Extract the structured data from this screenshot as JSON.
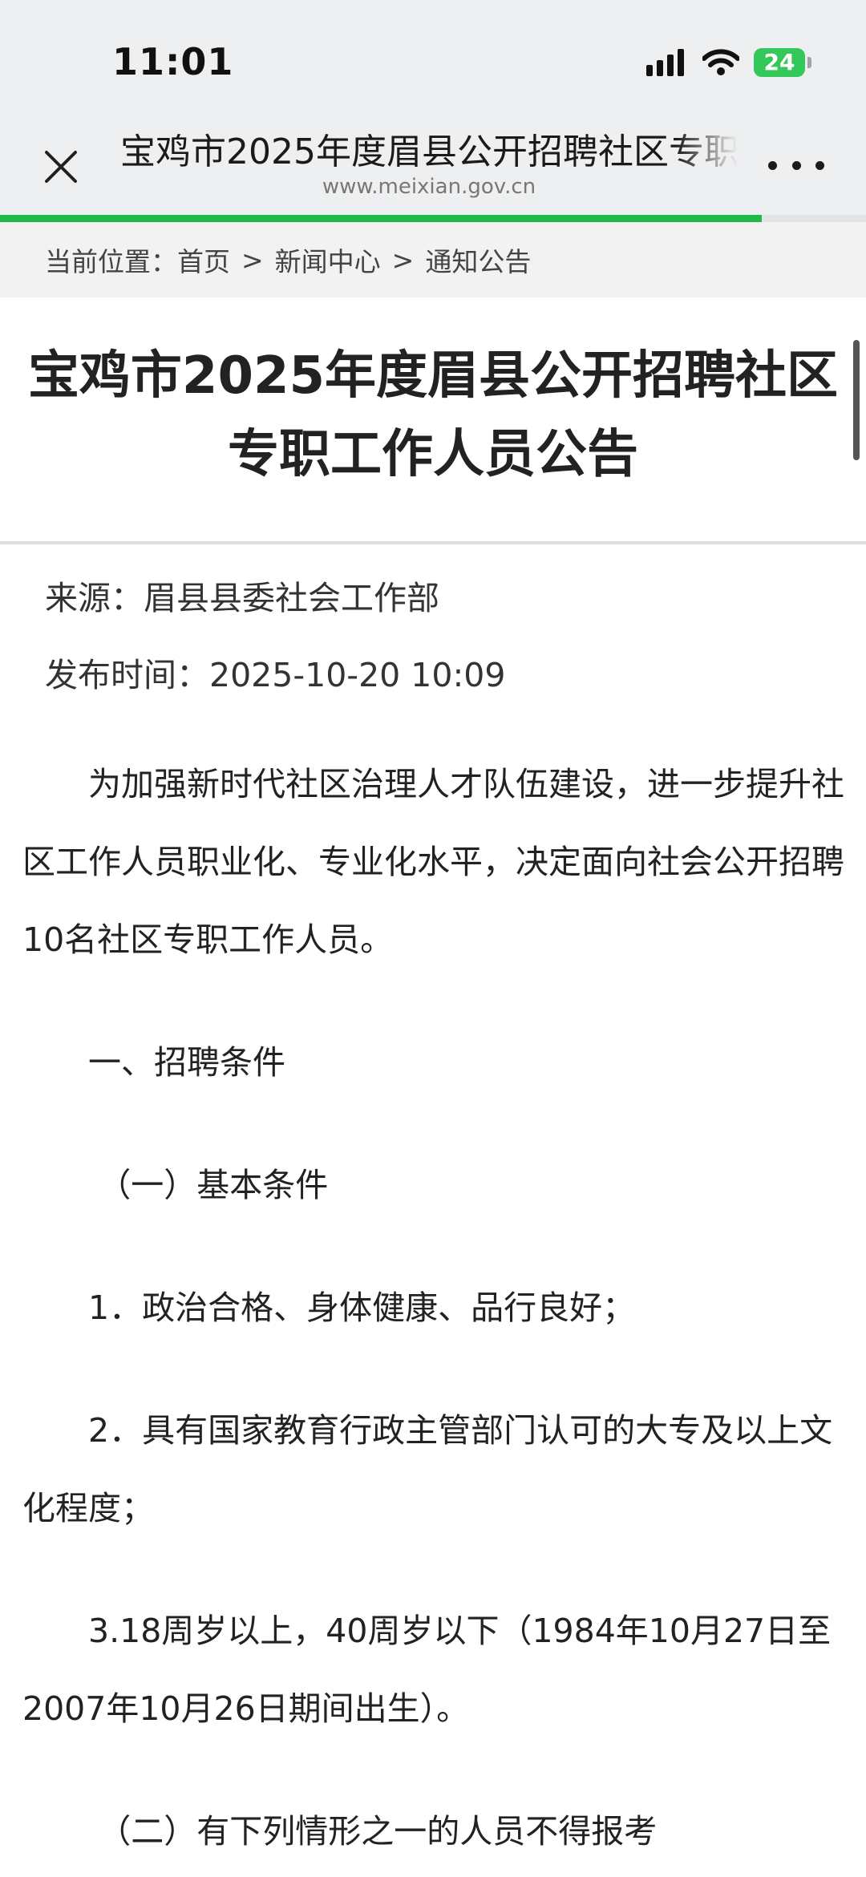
{
  "status_bar": {
    "time": "11:01",
    "battery": "24"
  },
  "browser": {
    "title": "宝鸡市2025年度眉县公开招聘社区专职工作人员公告",
    "url": "www.meixian.gov.cn",
    "load_progress": 0.88
  },
  "breadcrumb": {
    "prefix": "当前位置：",
    "items": [
      "首页",
      "新闻中心",
      "通知公告"
    ],
    "separator": ">"
  },
  "article": {
    "title_line1": "宝鸡市2025年度眉县公开招聘社区",
    "title_line2": "专职工作人员公告",
    "source": "来源：眉县县委社会工作部",
    "publish_time": "发布时间：2025-10-20 10:09",
    "paragraphs": [
      "为加强新时代社区治理人才队伍建设，进一步提升社区工作人员职业化、专业化水平，决定面向社会公开招聘10名社区专职工作人员。",
      "一、招聘条件",
      "（一）基本条件",
      "1．政治合格、身体健康、品行良好；",
      "2．具有国家教育行政主管部门认可的大专及以上文化程度；",
      "3.18周岁以上，40周岁以下（1984年10月27日至2007年10月26日期间出生）。",
      "（二）有下列情形之一的人员不得报考"
    ]
  },
  "colors": {
    "progress": "#20b84a",
    "battery": "#34c759",
    "chrome_bg": "#eeeff0"
  }
}
